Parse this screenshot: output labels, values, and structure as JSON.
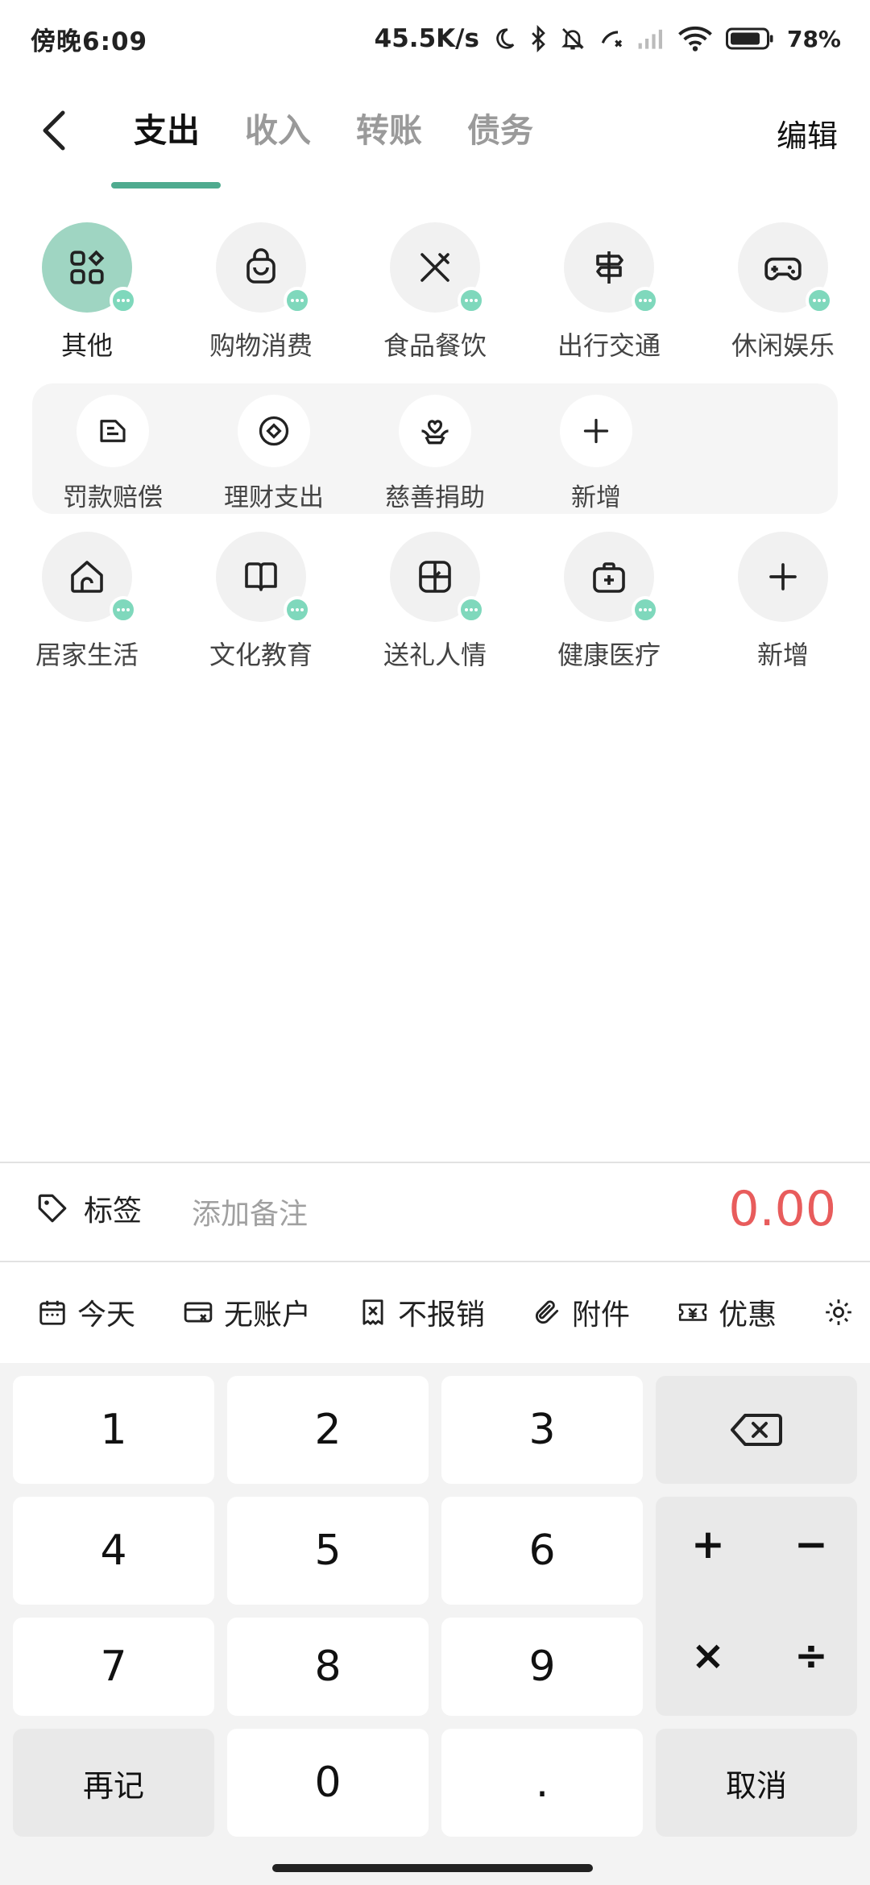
{
  "status_bar": {
    "time": "傍晚6:09",
    "speed": "45.5K/s",
    "battery": "78%"
  },
  "nav": {
    "tabs": [
      "支出",
      "收入",
      "转账",
      "债务"
    ],
    "active_tab": "支出",
    "edit_label": "编辑"
  },
  "categories_row1": [
    {
      "label": "其他",
      "icon": "grid-shapes-icon",
      "selected": true
    },
    {
      "label": "购物消费",
      "icon": "shopping-bag-icon"
    },
    {
      "label": "食品餐饮",
      "icon": "utensils-icon"
    },
    {
      "label": "出行交通",
      "icon": "signpost-icon"
    },
    {
      "label": "休闲娱乐",
      "icon": "gamepad-icon"
    }
  ],
  "subcategories": [
    {
      "label": "罚款赔偿",
      "icon": "fine-ticket-icon"
    },
    {
      "label": "理财支出",
      "icon": "coin-icon"
    },
    {
      "label": "慈善捐助",
      "icon": "heart-hands-icon"
    },
    {
      "label": "新增",
      "icon": "plus-icon"
    }
  ],
  "categories_row2": [
    {
      "label": "居家生活",
      "icon": "house-icon"
    },
    {
      "label": "文化教育",
      "icon": "book-icon"
    },
    {
      "label": "送礼人情",
      "icon": "gift-icon"
    },
    {
      "label": "健康医疗",
      "icon": "medical-kit-icon"
    },
    {
      "label": "新增",
      "icon": "plus-icon"
    }
  ],
  "note_bar": {
    "tag_label": "标签",
    "note_placeholder": "添加备注",
    "amount": "0.00"
  },
  "options": [
    {
      "label": "今天",
      "icon": "calendar-icon"
    },
    {
      "label": "无账户",
      "icon": "card-icon"
    },
    {
      "label": "不报销",
      "icon": "no-reimburse-icon"
    },
    {
      "label": "附件",
      "icon": "paperclip-icon"
    },
    {
      "label": "优惠",
      "icon": "coupon-icon"
    }
  ],
  "keypad": {
    "k1": "1",
    "k2": "2",
    "k3": "3",
    "k4": "4",
    "k5": "5",
    "k6": "6",
    "k7": "7",
    "k8": "8",
    "k9": "9",
    "k0": "0",
    "dot": ".",
    "again": "再记",
    "cancel": "取消",
    "plus": "+",
    "minus": "−",
    "times": "×",
    "divide": "÷"
  },
  "colors": {
    "accent": "#4fab8f",
    "selected_bg": "#9fd5c2",
    "badge": "#7fd8bc",
    "amount": "#e85c5c"
  }
}
